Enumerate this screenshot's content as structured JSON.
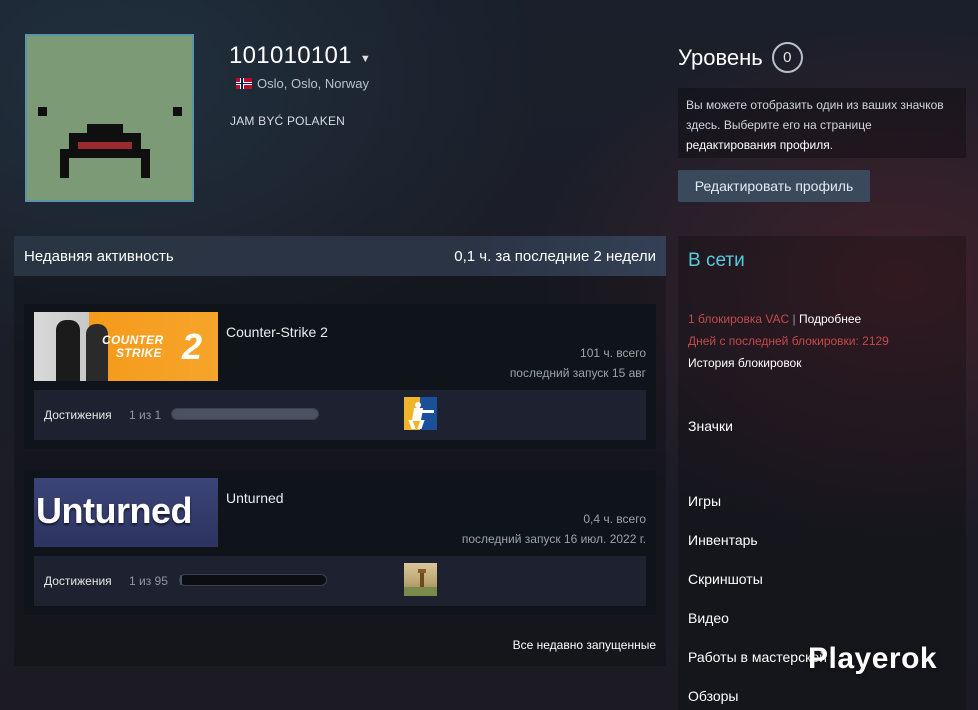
{
  "profile": {
    "persona_name": "101010101",
    "location": "Oslo, Oslo, Norway",
    "summary": "JAM BYĆ POLAKEN"
  },
  "level": {
    "label": "Уровень",
    "value": "0"
  },
  "badge_hint": {
    "text": "Вы можете отобразить один из ваших значков здесь. Выберите его на странице ",
    "link": "редактирования профиля",
    "end": "."
  },
  "edit_profile_label": "Редактировать профиль",
  "activity": {
    "title": "Недавняя активность",
    "hours_summary": "0,1 ч. за последние 2 недели",
    "all_recent_label": "Все недавно запущенные",
    "achievements_label": "Достижения",
    "games": [
      {
        "name": "Counter-Strike 2",
        "capsule_text": [
          "COUNTER",
          "STRIKE",
          "2"
        ],
        "total": "101 ч. всего",
        "last_played": "последний запуск 15 авг",
        "achievements": "1 из 1",
        "progress": 1.0
      },
      {
        "name": "Unturned",
        "capsule_text": [
          "Unturned"
        ],
        "total": "0,4 ч. всего",
        "last_played": "последний запуск 16 июл. 2022 г.",
        "achievements": "1 из 95",
        "progress": 0.0105
      }
    ]
  },
  "sidebar": {
    "status": "В сети",
    "vac_ban": "1 блокировка VAC",
    "vac_more": "Подробнее",
    "days_since_ban": "Дней с последней блокировки: 2129",
    "ban_history": "История блокировок",
    "links": [
      "Значки",
      "Игры",
      "Инвентарь",
      "Скриншоты",
      "Видео",
      "Работы в мастерской",
      "Обзоры"
    ]
  },
  "watermark": "Playerok",
  "colors": {
    "online": "#57cbde",
    "vac": "#c24a4a",
    "cs2_orange": "#f59a1b",
    "unturned_blue": "#323a6b"
  }
}
